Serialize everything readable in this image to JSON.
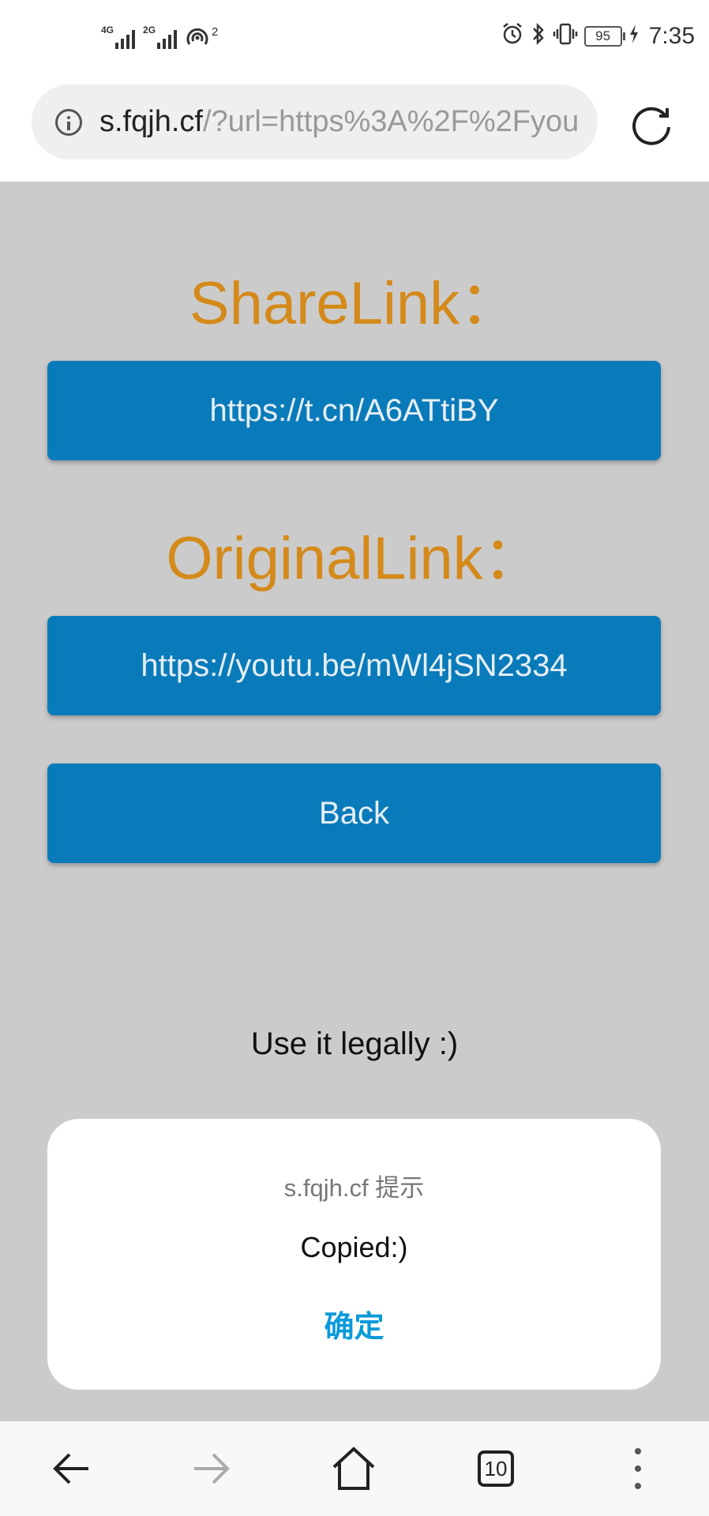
{
  "status_bar": {
    "net1": "4G",
    "net2": "2G",
    "hotspot_count": "2",
    "battery": "95",
    "time": "7:35"
  },
  "browser": {
    "url_host": "s.fqjh.cf",
    "url_rest": "/?url=https%3A%2F%2Fyou"
  },
  "page": {
    "share_heading": "ShareLink：",
    "share_link": "https://t.cn/A6ATtiBY",
    "original_heading": "OriginalLink：",
    "original_link": "https://youtu.be/mWl4jSN2334",
    "back_label": "Back",
    "legal_note": "Use it legally :)"
  },
  "dialog": {
    "title": "s.fqjh.cf 提示",
    "message": "Copied:)",
    "ok_label": "确定"
  },
  "bottom_nav": {
    "tab_count": "10"
  },
  "colors": {
    "accent": "#0a7bba",
    "heading": "#d48a1a",
    "background": "#cbcbcb",
    "dialog_ok": "#0a9ad9"
  }
}
